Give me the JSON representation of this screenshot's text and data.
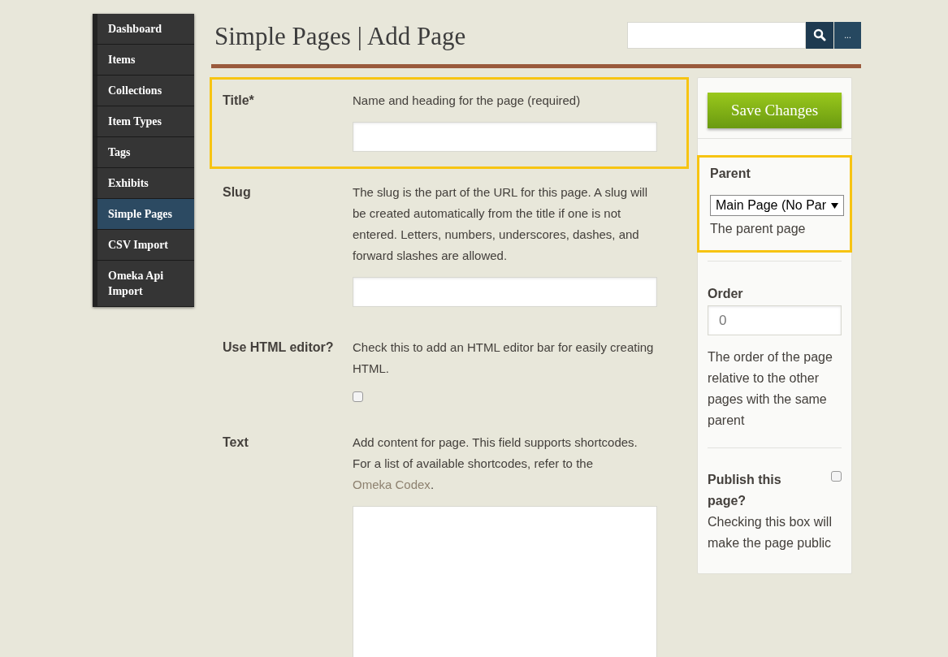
{
  "sidebar": {
    "items": [
      {
        "label": "Dashboard",
        "selected": false
      },
      {
        "label": "Items",
        "selected": false
      },
      {
        "label": "Collections",
        "selected": false
      },
      {
        "label": "Item Types",
        "selected": false
      },
      {
        "label": "Tags",
        "selected": false
      },
      {
        "label": "Exhibits",
        "selected": false
      },
      {
        "label": "Simple Pages",
        "selected": true
      },
      {
        "label": "CSV Import",
        "selected": false
      },
      {
        "label": "Omeka Api Import",
        "selected": false
      }
    ]
  },
  "header": {
    "title": "Simple Pages | Add Page",
    "search": {
      "more_label": "..."
    }
  },
  "form": {
    "fields": [
      {
        "kind": "text",
        "label": "Title*",
        "description": "Name and heading for the page (required)",
        "highlighted": true
      },
      {
        "kind": "text",
        "label": "Slug",
        "description": "The slug is the part of the URL for this page. A slug will be created automatically from the title if one is not entered. Letters, numbers, underscores, dashes, and forward slashes are allowed.",
        "highlighted": false
      },
      {
        "kind": "checkbox",
        "label": "Use HTML editor?",
        "description": "Check this to add an HTML editor bar for easily creating HTML.",
        "checked": false,
        "highlighted": false
      },
      {
        "kind": "textarea",
        "label": "Text",
        "description": "Add content for page. This field supports shortcodes. For a list of available shortcodes, refer to the ",
        "link": "Omeka Codex",
        "description_end": ".",
        "highlighted": false
      }
    ]
  },
  "panel": {
    "save_button": "Save Changes",
    "parent": {
      "label": "Parent",
      "value": "Main Page (No Par",
      "hint": "The parent page",
      "highlighted": true
    },
    "order": {
      "label": "Order",
      "value": "0",
      "hint": "The order of the page relative to the other pages with the same parent"
    },
    "publish": {
      "label": "Publish this page?",
      "hint": "Checking this box will make the page public",
      "checked": false
    }
  }
}
